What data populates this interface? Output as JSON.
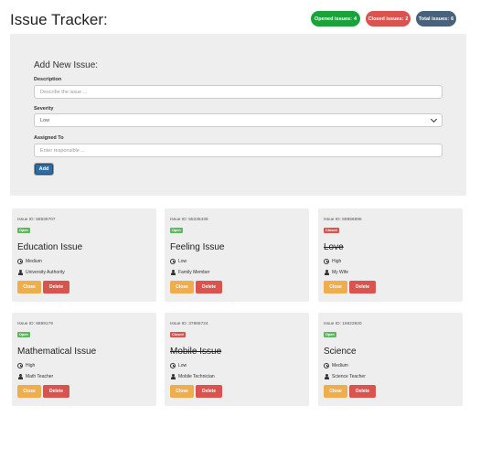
{
  "header": {
    "title": "Issue Tracker:"
  },
  "badges": {
    "opened_label": "Opened issues:",
    "opened_count": "4",
    "closed_label": "Closed issues:",
    "closed_count": "2",
    "total_label": "Total issues:",
    "total_count": "6"
  },
  "form": {
    "heading": "Add New Issue:",
    "description_label": "Description",
    "description_placeholder": "Describe the issue ...",
    "severity_label": "Severity",
    "severity_value": "Low",
    "assigned_label": "Assigned To",
    "assigned_placeholder": "Enter responsible ...",
    "add_label": "Add"
  },
  "issues": [
    {
      "id_text": "Issue ID: 58836707",
      "status": "Open",
      "description": "Education Issue",
      "severity": "Medium",
      "assigned": "University Authority",
      "close_label": "Close",
      "delete_label": "Delete"
    },
    {
      "id_text": "Issue ID: 55235439",
      "status": "Open",
      "description": "Feeling Issue",
      "severity": "Low",
      "assigned": "Family Member",
      "close_label": "Close",
      "delete_label": "Delete"
    },
    {
      "id_text": "Issue ID: 69858895",
      "status": "Closed",
      "description": "Love",
      "severity": "High",
      "assigned": "My Wife",
      "close_label": "Close",
      "delete_label": "Delete"
    },
    {
      "id_text": "Issue ID: 8889179",
      "status": "Open",
      "description": "Mathematical Issue",
      "severity": "High",
      "assigned": "Math Teacher",
      "close_label": "Close",
      "delete_label": "Delete"
    },
    {
      "id_text": "Issue ID: 37865724",
      "status": "Closed",
      "description": "Mobile Issue",
      "severity": "Low",
      "assigned": "Mobile Technician",
      "close_label": "Close",
      "delete_label": "Delete"
    },
    {
      "id_text": "Issue ID: 16823920",
      "status": "Open",
      "description": "Science",
      "severity": "Medium",
      "assigned": "Science Teacher",
      "close_label": "Close",
      "delete_label": "Delete"
    }
  ],
  "colors": {
    "open": "#1aa33a",
    "closed": "#d9534f",
    "total": "#4a6279",
    "add_button": "#2e6da4",
    "close_button": "#f0ad4e",
    "delete_button": "#d9534f"
  }
}
